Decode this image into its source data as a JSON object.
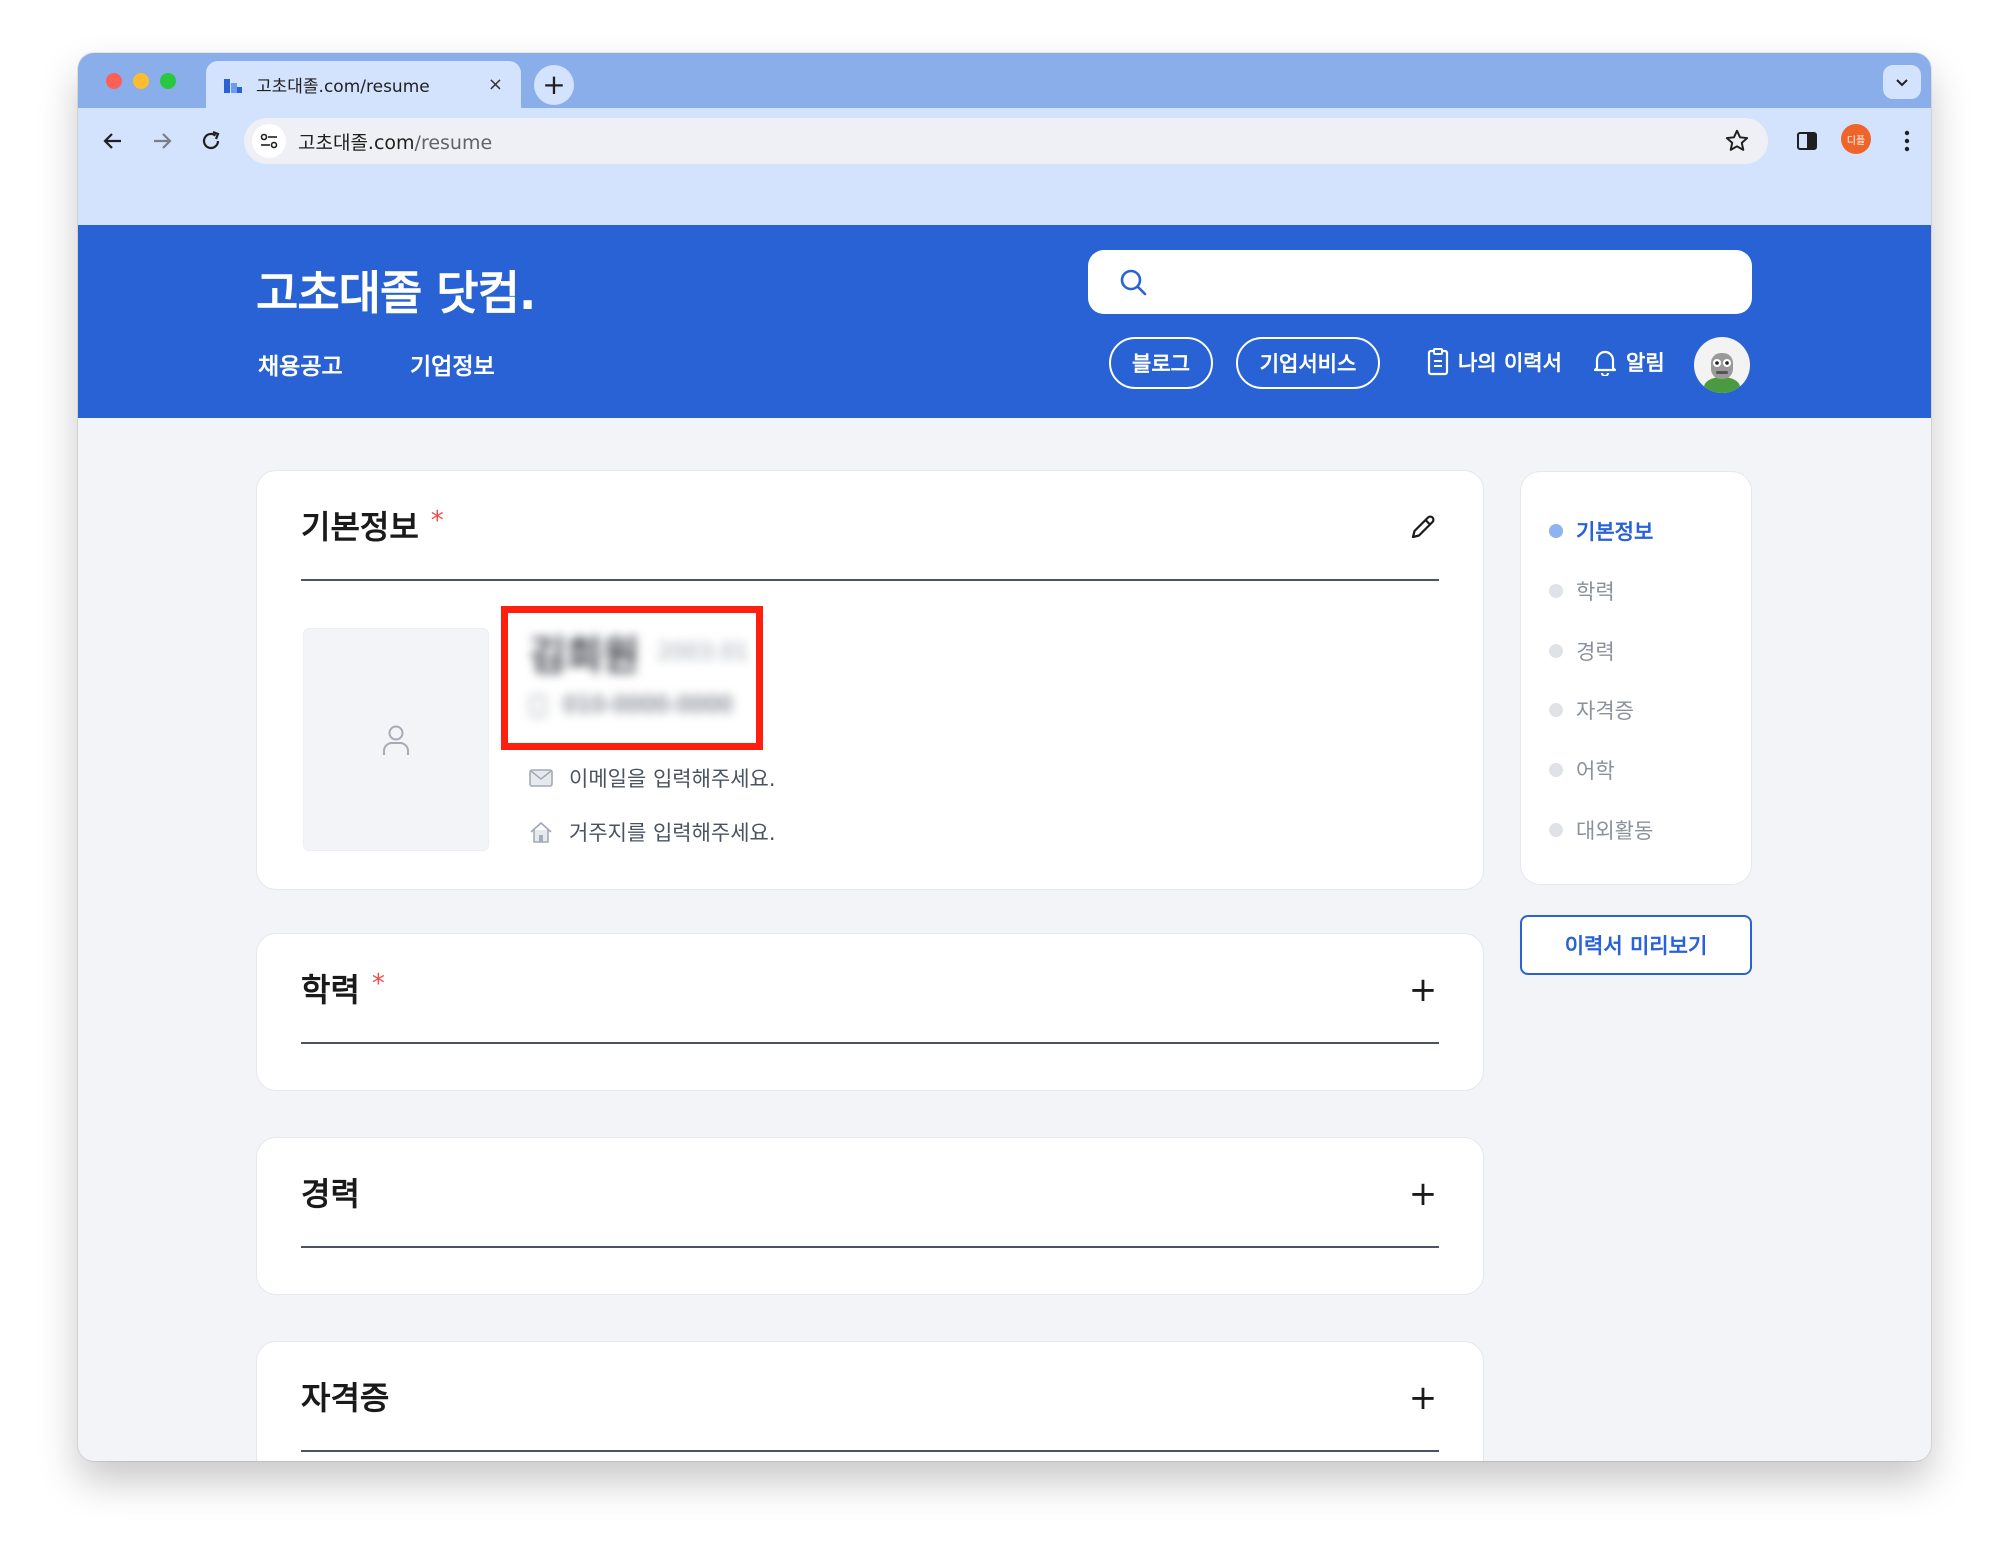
{
  "browser": {
    "tab_title": "고초대졸.com/resume",
    "tab_close": "×",
    "new_tab": "+",
    "url_domain": "고초대졸.com",
    "url_path": "/resume",
    "profile_label": "디플"
  },
  "header": {
    "logo": "고초대졸 닷컴.",
    "search_placeholder": "",
    "nav": [
      "채용공고",
      "기업정보"
    ],
    "blog_button": "블로그",
    "business_button": "기업서비스",
    "my_resume": "나의 이력서",
    "notifications": "알림"
  },
  "basic_info": {
    "title": "기본정보",
    "required_mark": "*",
    "name_blurred": "김희원",
    "birth_blurred": "2003.01",
    "phone_blurred": "010-0000-0000",
    "email_placeholder": "이메일을 입력해주세요.",
    "address_placeholder": "거주지를 입력해주세요."
  },
  "sections": [
    {
      "title": "학력",
      "required": "*",
      "action": "+"
    },
    {
      "title": "경력",
      "required": "",
      "action": "+"
    },
    {
      "title": "자격증",
      "required": "",
      "action": "+"
    }
  ],
  "side_nav": {
    "items": [
      "기본정보",
      "학력",
      "경력",
      "자격증",
      "어학",
      "대외활동"
    ],
    "active_index": 0
  },
  "preview_button": "이력서 미리보기",
  "colors": {
    "brand_blue": "#2962d4",
    "required_red": "#ef4b4b",
    "highlight_box": "#ff1f0f"
  }
}
